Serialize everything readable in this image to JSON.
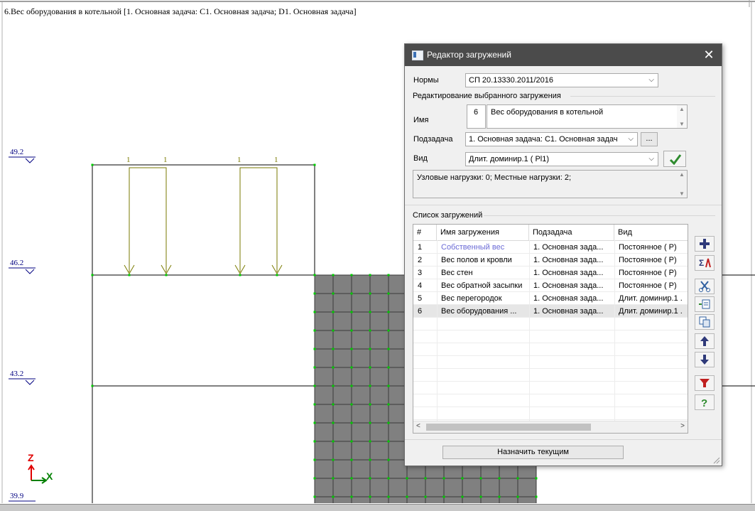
{
  "view": {
    "header": "6.Вес оборудования в котельной [1. Основная задача: C1. Основная задача; D1. Основная задача]",
    "levels": [
      "49.2",
      "46.2",
      "43.2",
      "39.9"
    ],
    "load_labels": [
      "1",
      "1",
      "1",
      "1"
    ],
    "axes": {
      "z": "Z",
      "x": "X"
    }
  },
  "dialog": {
    "title": "Редактор загружений",
    "norms_label": "Нормы",
    "norms_value": "СП 20.13330.2011/2016",
    "edit_section_label": "Редактирование выбранного загружения",
    "name_label": "Имя",
    "load_number": "6",
    "load_name": "Вес оборудования в котельной",
    "subtask_label": "Подзадача",
    "subtask_value": "1. Основная задача: C1. Основная задач",
    "subtask_more": "...",
    "kind_label": "Вид",
    "kind_value": "Длит. доминир.1 ( Pl1)",
    "info_text": "Узловые нагрузки:  0;  Местные нагрузки:  2;",
    "list_label": "Список загружений",
    "columns": [
      "#",
      "Имя загружения",
      "Подзадача",
      "Вид"
    ],
    "rows": [
      [
        "1",
        "Собственный вес",
        "1. Основная зада...",
        "Постоянное ( P)"
      ],
      [
        "2",
        "Вес полов и кровли",
        "1. Основная зада...",
        "Постоянное ( P)"
      ],
      [
        "3",
        "Вес стен",
        "1. Основная зада...",
        "Постоянное ( P)"
      ],
      [
        "4",
        "Вес обратной засыпки",
        "1. Основная зада...",
        "Постоянное ( P)"
      ],
      [
        "5",
        "Вес перегородок",
        "1. Основная зада...",
        "Длит. доминир.1 ."
      ],
      [
        "6",
        "Вес оборудования ...",
        "1. Основная зада...",
        "Длит. доминир.1 ."
      ]
    ],
    "selected_row": 6,
    "assign_button": "Назначить текущим",
    "side_buttons": [
      "add-icon",
      "sum-icon",
      "cut-icon",
      "insert-icon",
      "copy-icon",
      "arrow-up-icon",
      "arrow-down-icon",
      "filter-icon",
      "help-icon"
    ]
  },
  "colors": {
    "titlebar": "#4b4b4b",
    "level_text": "#000080",
    "load_arrows": "#7a7a00",
    "mesh_fill": "#808080",
    "mesh_nodes": "#00cc00",
    "first_row_text": "#6b6bd6",
    "axis_z": "#e00000",
    "axis_x": "#008000"
  }
}
